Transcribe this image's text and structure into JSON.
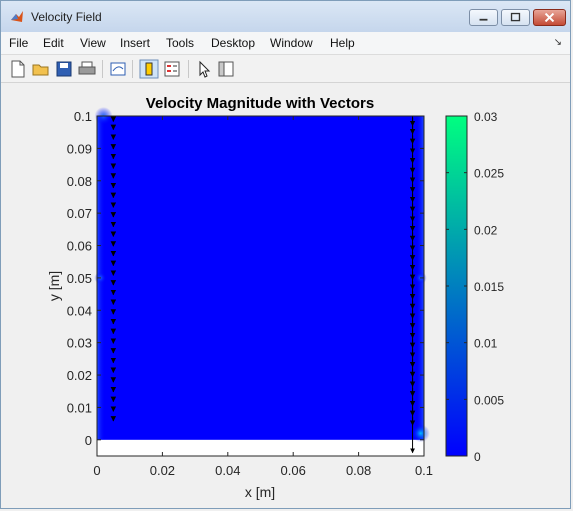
{
  "window": {
    "title": "Velocity Field"
  },
  "menu": {
    "items": [
      "File",
      "Edit",
      "View",
      "Insert",
      "Tools",
      "Desktop",
      "Window",
      "Help"
    ]
  },
  "toolbar": {
    "icons": [
      "new-figure-icon",
      "open-file-icon",
      "save-icon",
      "print-icon",
      "link-plot-icon",
      "insert-colorbar-icon",
      "insert-legend-icon",
      "edit-plot-arrow-icon",
      "property-inspector-icon"
    ]
  },
  "chart_data": {
    "type": "heatmap",
    "title": "Velocity Magnitude with Vectors",
    "xlabel": "x [m]",
    "ylabel": "y [m]",
    "xlim": [
      0,
      0.1
    ],
    "ylim": [
      -0.005,
      0.1
    ],
    "x_ticks": [
      "0",
      "0.02",
      "0.04",
      "0.06",
      "0.08",
      "0.1"
    ],
    "y_ticks": [
      "0",
      "0.01",
      "0.02",
      "0.03",
      "0.04",
      "0.05",
      "0.06",
      "0.07",
      "0.08",
      "0.09",
      "0.1"
    ],
    "colorbar": {
      "min": 0,
      "max": 0.03,
      "ticks": [
        "0",
        "0.005",
        "0.01",
        "0.015",
        "0.02",
        "0.025",
        "0.03"
      ],
      "colormap": "winter",
      "color_low": "#0000ff",
      "color_high": "#00ff80"
    },
    "field": {
      "x_range": [
        0,
        0.1
      ],
      "y_range": [
        0,
        0.1
      ],
      "background_magnitude": 0.001,
      "hotspots": [
        {
          "x": 0.002,
          "y": 0.1,
          "magnitude": 0.008
        },
        {
          "x": 0.099,
          "y": 0.002,
          "magnitude": 0.01
        },
        {
          "x": 0.001,
          "y": 0.05,
          "magnitude": 0.004
        },
        {
          "x": 0.099,
          "y": 0.05,
          "magnitude": 0.004
        }
      ]
    },
    "vectors": {
      "left_column": {
        "x": 0.005,
        "y_values": [
          0.0995,
          0.097,
          0.094,
          0.091,
          0.088,
          0.085,
          0.082,
          0.079,
          0.076,
          0.073,
          0.07,
          0.067,
          0.064,
          0.061,
          0.058,
          0.055,
          0.052,
          0.049,
          0.046,
          0.043,
          0.04,
          0.037,
          0.034,
          0.031,
          0.028,
          0.025,
          0.022,
          0.019,
          0.016,
          0.013,
          0.01,
          0.007
        ],
        "dy": -0.0012
      },
      "right_column": {
        "x": 0.0965,
        "y_values": [
          0.0995,
          0.097,
          0.094,
          0.091,
          0.088,
          0.085,
          0.082,
          0.079,
          0.076,
          0.073,
          0.07,
          0.067,
          0.064,
          0.061,
          0.058,
          0.055,
          0.052,
          0.049,
          0.046,
          0.043,
          0.04,
          0.037,
          0.034,
          0.031,
          0.028,
          0.025,
          0.022,
          0.019,
          0.016,
          0.013,
          0.01,
          0.007
        ],
        "dy": -0.0025
      },
      "long_arrow": {
        "x": 0.0965,
        "y_start": 0.1,
        "y_end": -0.004
      }
    }
  }
}
